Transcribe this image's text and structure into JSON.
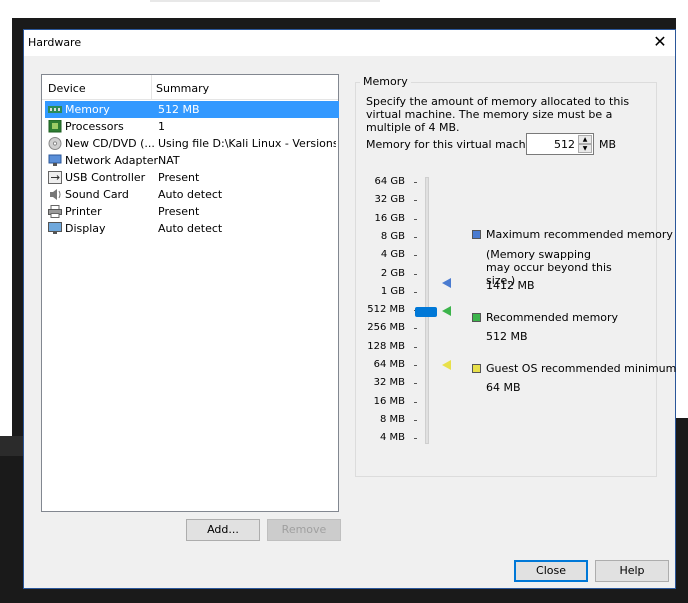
{
  "window": {
    "title": "Hardware"
  },
  "list": {
    "headers": {
      "device": "Device",
      "summary": "Summary"
    },
    "rows": [
      {
        "device": "Memory",
        "summary": "512 MB",
        "icon": "memory-icon"
      },
      {
        "device": "Processors",
        "summary": "1",
        "icon": "processor-icon"
      },
      {
        "device": "New CD/DVD (...",
        "summary": "Using file D:\\Kali Linux - Versions\\...",
        "icon": "cd-dvd-icon"
      },
      {
        "device": "Network Adapter",
        "summary": "NAT",
        "icon": "network-adapter-icon"
      },
      {
        "device": "USB Controller",
        "summary": "Present",
        "icon": "usb-icon"
      },
      {
        "device": "Sound Card",
        "summary": "Auto detect",
        "icon": "sound-card-icon"
      },
      {
        "device": "Printer",
        "summary": "Present",
        "icon": "printer-icon"
      },
      {
        "device": "Display",
        "summary": "Auto detect",
        "icon": "display-icon"
      }
    ],
    "selected_index": 0
  },
  "buttons": {
    "add": "Add...",
    "remove": "Remove",
    "close": "Close",
    "help": "Help"
  },
  "memory": {
    "group_title": "Memory",
    "description": "Specify the amount of memory allocated to this virtual machine. The memory size must be a multiple of 4 MB.",
    "field_label": "Memory for this virtual machine:",
    "value": "512",
    "unit": "MB",
    "ticks": [
      "64 GB",
      "32 GB",
      "16 GB",
      "8 GB",
      "4 GB",
      "2 GB",
      "1 GB",
      "512 MB",
      "256 MB",
      "128 MB",
      "64 MB",
      "32 MB",
      "16 MB",
      "8 MB",
      "4 MB"
    ],
    "legend": {
      "max_title": "Maximum recommended memory",
      "max_note": "(Memory swapping may occur beyond this size.)",
      "max_value": "1412 MB",
      "rec_title": "Recommended memory",
      "rec_value": "512 MB",
      "min_title": "Guest OS recommended minimum",
      "min_value": "64 MB"
    },
    "colors": {
      "max": "#4a7bd0",
      "recommended": "#3cb44b",
      "minimum": "#e8e04a",
      "slider": "#0078d7"
    }
  }
}
